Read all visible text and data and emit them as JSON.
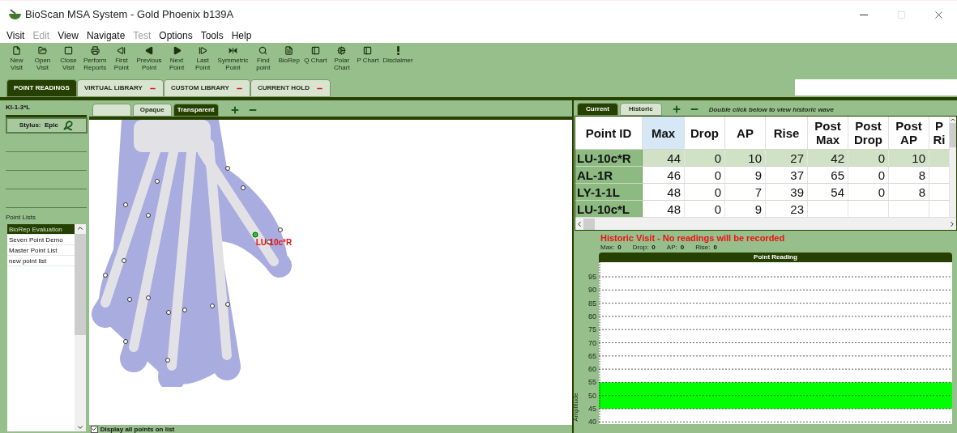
{
  "window": {
    "title": "BioScan MSA System - Gold Phoenix b139A"
  },
  "menu": [
    {
      "label": "Visit",
      "disabled": false
    },
    {
      "label": "Edit",
      "disabled": true
    },
    {
      "label": "View",
      "disabled": false
    },
    {
      "label": "Navigate",
      "disabled": false
    },
    {
      "label": "Test",
      "disabled": true
    },
    {
      "label": "Options",
      "disabled": false
    },
    {
      "label": "Tools",
      "disabled": false
    },
    {
      "label": "Help",
      "disabled": false
    }
  ],
  "toolbar": [
    {
      "label": "New\nVisit"
    },
    {
      "label": "Open\nVisit"
    },
    {
      "label": "Close\nVisit"
    },
    {
      "label": "Perform\nReports"
    },
    {
      "label": "First\nPoint"
    },
    {
      "label": "Previous\nPoint"
    },
    {
      "label": "Next\nPoint"
    },
    {
      "label": "Last\nPoint"
    },
    {
      "label": "Symmetric\nPoint"
    },
    {
      "label": "Find\npoint"
    },
    {
      "label": "BioRep"
    },
    {
      "label": "Q Chart"
    },
    {
      "label": "Polar\nChart"
    },
    {
      "label": "P Chart"
    },
    {
      "label": "Disclaimer"
    }
  ],
  "tabs": [
    {
      "label": "POINT READINGS",
      "selected": true,
      "closable": false
    },
    {
      "label": "VIRTUAL LIBRARY",
      "selected": false,
      "closable": true
    },
    {
      "label": "CUSTOM LIBRARY",
      "selected": false,
      "closable": true
    },
    {
      "label": "CURRENT HOLD",
      "selected": false,
      "closable": true
    }
  ],
  "left_panel": {
    "point_label": "KI-1-3*L",
    "stylus_button": "Stylus:  Epic",
    "point_lists_title": "Point Lists",
    "point_lists": [
      {
        "label": "BioRep Evaluation",
        "selected": true
      },
      {
        "label": "Seven Point Demo",
        "selected": false
      },
      {
        "label": "Master Point List",
        "selected": false
      },
      {
        "label": "new point list",
        "selected": false
      }
    ]
  },
  "view_tabs": [
    {
      "label": "Opaque",
      "selected": false
    },
    {
      "label": "Transparent",
      "selected": true
    }
  ],
  "hand_view": {
    "selected_point_label": "LU-10c*R",
    "display_all_points": {
      "label": "Display all points on list",
      "checked": true
    }
  },
  "result_tabs": [
    {
      "label": "Current",
      "selected": true
    },
    {
      "label": "Historic",
      "selected": false
    }
  ],
  "result_hint": "Double click below to view historic wave",
  "table": {
    "columns": [
      {
        "label": "Point ID",
        "selected": false
      },
      {
        "label": "Max",
        "selected": true
      },
      {
        "label": "Drop",
        "selected": false
      },
      {
        "label": "AP",
        "selected": false
      },
      {
        "label": "Rise",
        "selected": false
      },
      {
        "label": "Post Max",
        "selected": false
      },
      {
        "label": "Post Drop",
        "selected": false
      },
      {
        "label": "Post AP",
        "selected": false
      },
      {
        "label": "P Ri",
        "selected": false
      }
    ],
    "rows": [
      {
        "selected": true,
        "cells": [
          "LU-10c*R",
          "44",
          "0",
          "10",
          "27",
          "42",
          "0",
          "10",
          null
        ]
      },
      {
        "selected": false,
        "cells": [
          "AL-1R",
          "46",
          "0",
          "9",
          "37",
          "65",
          "0",
          "8",
          null
        ]
      },
      {
        "selected": false,
        "cells": [
          "LY-1-1L",
          "48",
          "0",
          "7",
          "39",
          "54",
          "0",
          "8",
          null
        ]
      },
      {
        "selected": false,
        "cells": [
          "LU-10c*L",
          "48",
          "0",
          "9",
          "23",
          null,
          null,
          null,
          null
        ]
      }
    ]
  },
  "historic_message": "Historic Visit - No readings will be recorded",
  "stats": [
    {
      "label": "Max:",
      "value": "0"
    },
    {
      "label": "Drop:",
      "value": "0"
    },
    {
      "label": "AP:",
      "value": "0"
    },
    {
      "label": "Rise:",
      "value": "0"
    }
  ],
  "reading_panel": {
    "title": "Point Reading",
    "axis_label": "Amplitude",
    "tick_labels": [
      "95",
      "90",
      "85",
      "80",
      "75",
      "70",
      "65",
      "60",
      "55",
      "50",
      "45",
      "40"
    ]
  }
}
